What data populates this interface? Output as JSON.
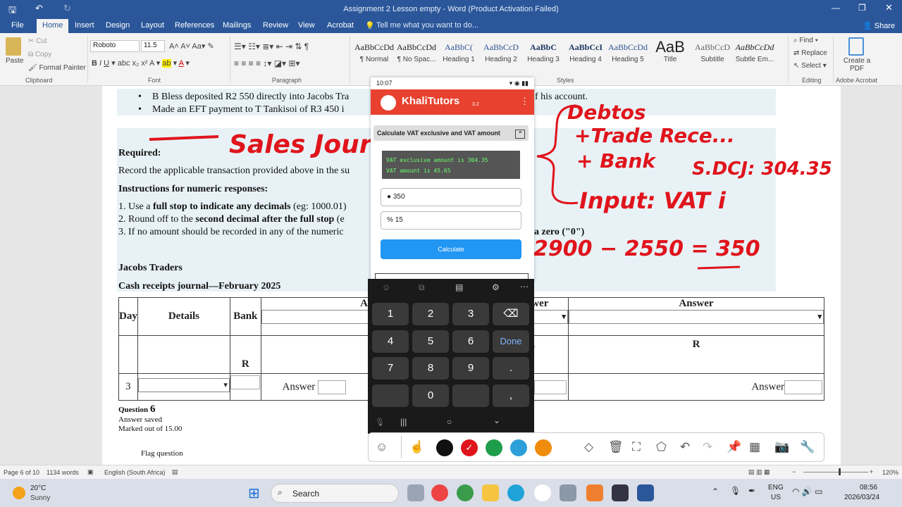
{
  "window": {
    "title": "Assignment 2 Lesson empty - Word (Product Activation Failed)"
  },
  "tabs": [
    "File",
    "Home",
    "Insert",
    "Design",
    "Layout",
    "References",
    "Mailings",
    "Review",
    "View",
    "Acrobat"
  ],
  "tell_me": "Tell me what you want to do...",
  "share": "Share",
  "ribbon": {
    "clipboard": {
      "paste": "Paste",
      "cut": "Cut",
      "copy": "Copy",
      "format_painter": "Format Painter",
      "label": "Clipboard"
    },
    "font": {
      "name": "Roboto",
      "size": "11.5",
      "label": "Font"
    },
    "paragraph": {
      "label": "Paragraph"
    },
    "styles": {
      "label": "Styles",
      "items": [
        {
          "sample": "AaBbCcDd",
          "name": "¶ Normal"
        },
        {
          "sample": "AaBbCcDd",
          "name": "¶ No Spac..."
        },
        {
          "sample": "AaBbC(",
          "name": "Heading 1"
        },
        {
          "sample": "AaBbCcD",
          "name": "Heading 2"
        },
        {
          "sample": "AaBbC",
          "name": "Heading 3"
        },
        {
          "sample": "AaBbCcI",
          "name": "Heading 4"
        },
        {
          "sample": "AaBbCcDd",
          "name": "Heading 5"
        },
        {
          "sample": "AaB",
          "name": "Title"
        },
        {
          "sample": "AaBbCcD",
          "name": "Subtitle"
        },
        {
          "sample": "AaBbCcDd",
          "name": "Subtle Em..."
        }
      ]
    },
    "editing": {
      "find": "Find",
      "replace": "Replace",
      "select": "Select",
      "label": "Editing"
    },
    "acrobat": {
      "create": "Create a PDF",
      "label": "Adobe Acrobat"
    }
  },
  "document": {
    "bullet1": "B Bless deposited R2 550 directly into Jacobs Tra",
    "bullet1_end": "f his account.",
    "bullet2": "Made an EFT payment to  T Tankisoi of R3 450 i",
    "required": "Required:",
    "record": "Record the applicable transaction provided above in the su",
    "instructions": "Instructions for numeric responses:",
    "inst1_pre": "1.  Use a ",
    "inst1_bold": "full stop to indicate any decimals",
    "inst1_post": " (eg: 1000.01)",
    "inst2_pre": "2.  Round off to the ",
    "inst2_bold": "second decimal after the full stop",
    "inst2_post": " (e",
    "inst3": "3.  If no amount should be recorded in any of the numeric",
    "inst3_end": "a zero (\"0\")",
    "company": "Jacobs Traders",
    "journal": "Cash receipts journal—February 2025",
    "table": {
      "day": "Day",
      "details": "Details",
      "bank": "Bank",
      "answer": "Answer",
      "r": "R",
      "row_day": "3"
    },
    "question_label": "Question",
    "question_num": "6",
    "answer_saved": "Answer saved",
    "marked": "Marked out of 15.00",
    "flag": "Flag question"
  },
  "annotations": {
    "sales_journal": "Sales Jour",
    "debtors": "Debtos",
    "trade": "+Trade Rece...",
    "bank": "+ Bank",
    "sdcj": "S.DCJ: 304.35",
    "input": "Input:  VAT i",
    "calc": "2900 − 2550 = 350"
  },
  "phone": {
    "time": "10:07",
    "app": "KhaliTutors",
    "version": "3.2",
    "card_title": "Calculate VAT exclusive and VAT amount",
    "result1": "VAT exclusive amount is 304.35",
    "result2": "VAT amount is 45.65",
    "amount": "350",
    "percent": "15",
    "calculate": "Calculate",
    "keys": [
      "1",
      "2",
      "3",
      "4",
      "5",
      "6",
      "7",
      "8",
      "9",
      ".",
      "0",
      ","
    ],
    "done": "Done"
  },
  "pen_colors": [
    "#111111",
    "#e0141c",
    "#1e9e4a",
    "#2d9fd8",
    "#f08c0c"
  ],
  "statusbar": {
    "page": "Page 6 of 10",
    "words": "1134 words",
    "lang": "English (South Africa)",
    "zoom": "120%"
  },
  "taskbar": {
    "temp": "20°C",
    "weather": "Sunny",
    "search": "Search",
    "lang1": "ENG",
    "lang2": "US",
    "time": "08:56",
    "date": "2026/03/24"
  }
}
